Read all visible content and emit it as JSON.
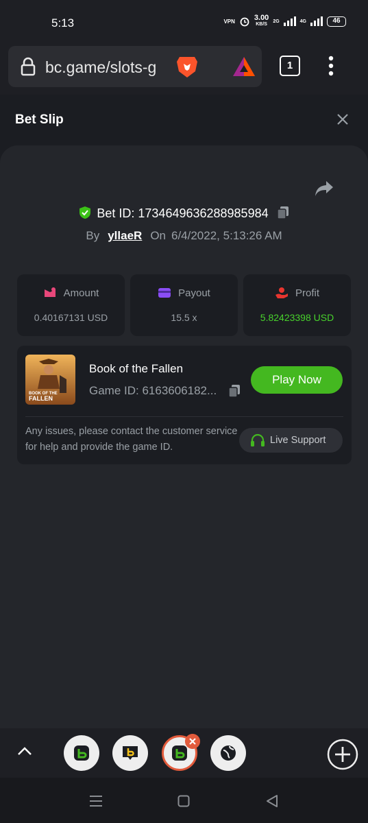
{
  "status_bar": {
    "time": "5:13",
    "vpn": "VPN",
    "speed_value": "3.00",
    "speed_unit": "KB/S",
    "net1": "2G",
    "net2": "4G",
    "battery": "46"
  },
  "browser": {
    "url": "bc.game/slots-g",
    "tab_count": "1"
  },
  "header": {
    "title": "Bet Slip"
  },
  "bet": {
    "bet_id_label": "Bet ID: 1734649636288985984",
    "by_label": "By",
    "username": "yllaeR",
    "on_label": "On",
    "datetime": "6/4/2022, 5:13:26 AM"
  },
  "stats": {
    "amount_label": "Amount",
    "amount_value": "0.40167131 USD",
    "payout_label": "Payout",
    "payout_value": "15.5 x",
    "profit_label": "Profit",
    "profit_value": "5.82423398 USD"
  },
  "game": {
    "thumb_line1": "BOOK OF THE",
    "thumb_line2": "FALLEN",
    "name": "Book of the Fallen",
    "game_id": "Game ID: 6163606182...",
    "play_label": "Play Now",
    "help_text": "Any issues, please contact the customer service for help and provide the game ID.",
    "support_label": "Live Support"
  },
  "colors": {
    "accent_green": "#44b820",
    "profit_green": "#48d22c",
    "panel_bg": "#24262b",
    "card_bg": "#1b1d22"
  }
}
